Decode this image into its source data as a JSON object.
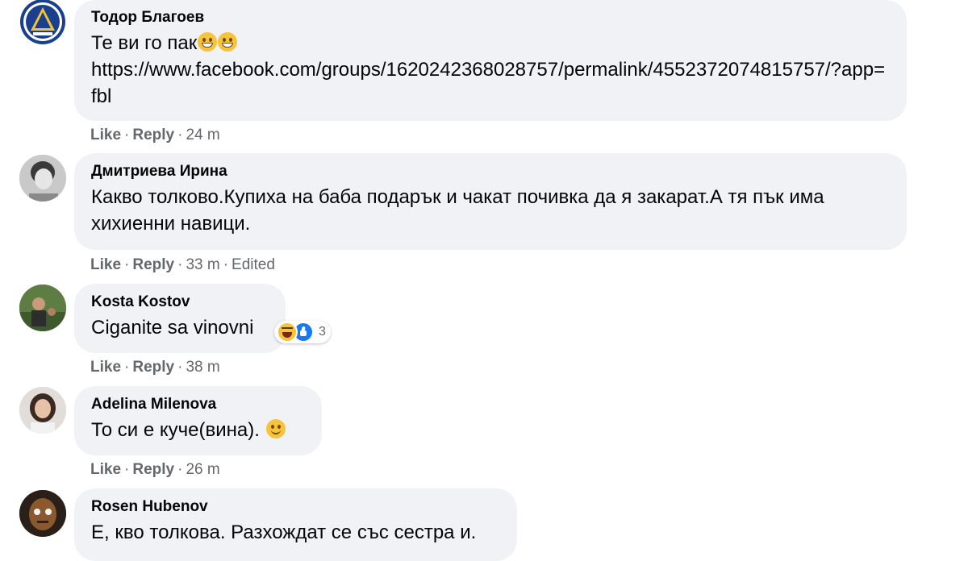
{
  "comments": [
    {
      "author": "Тодор Благоев",
      "text_line1": "Те ви го пак",
      "link": "https://www.facebook.com/groups/1620242368028757/permalink/4552372074815757/?app=fbl",
      "like": "Like",
      "reply": "Reply",
      "time": "24 m",
      "avatar_icon": "club-crest-icon"
    },
    {
      "author": "Дмитриева Ирина",
      "text": "Какво толково.Купиха на баба подарък и чакат почивка да я закарат.А тя пък има хихиенни навици.",
      "like": "Like",
      "reply": "Reply",
      "time": "33 m",
      "edited": "Edited",
      "avatar_icon": "profile-photo-icon"
    },
    {
      "author": "Kosta Kostov",
      "text": "Ciganite sa vinovni",
      "reaction_count": "3",
      "like": "Like",
      "reply": "Reply",
      "time": "38 m",
      "avatar_icon": "profile-photo-icon"
    },
    {
      "author": "Adelina Milenova",
      "text": "То си е куче(вина).",
      "like": "Like",
      "reply": "Reply",
      "time": "26 m",
      "avatar_icon": "profile-photo-icon"
    },
    {
      "author": "Rosen Hubenov",
      "text": "Е, кво толкова. Разхождат се със сестра и.",
      "avatar_icon": "profile-photo-icon"
    }
  ],
  "colors": {
    "bubble": "#f0f2f5",
    "meta_text": "#65676b",
    "like_blue": "#1877f2",
    "crest_blue": "#1b3f8f"
  }
}
